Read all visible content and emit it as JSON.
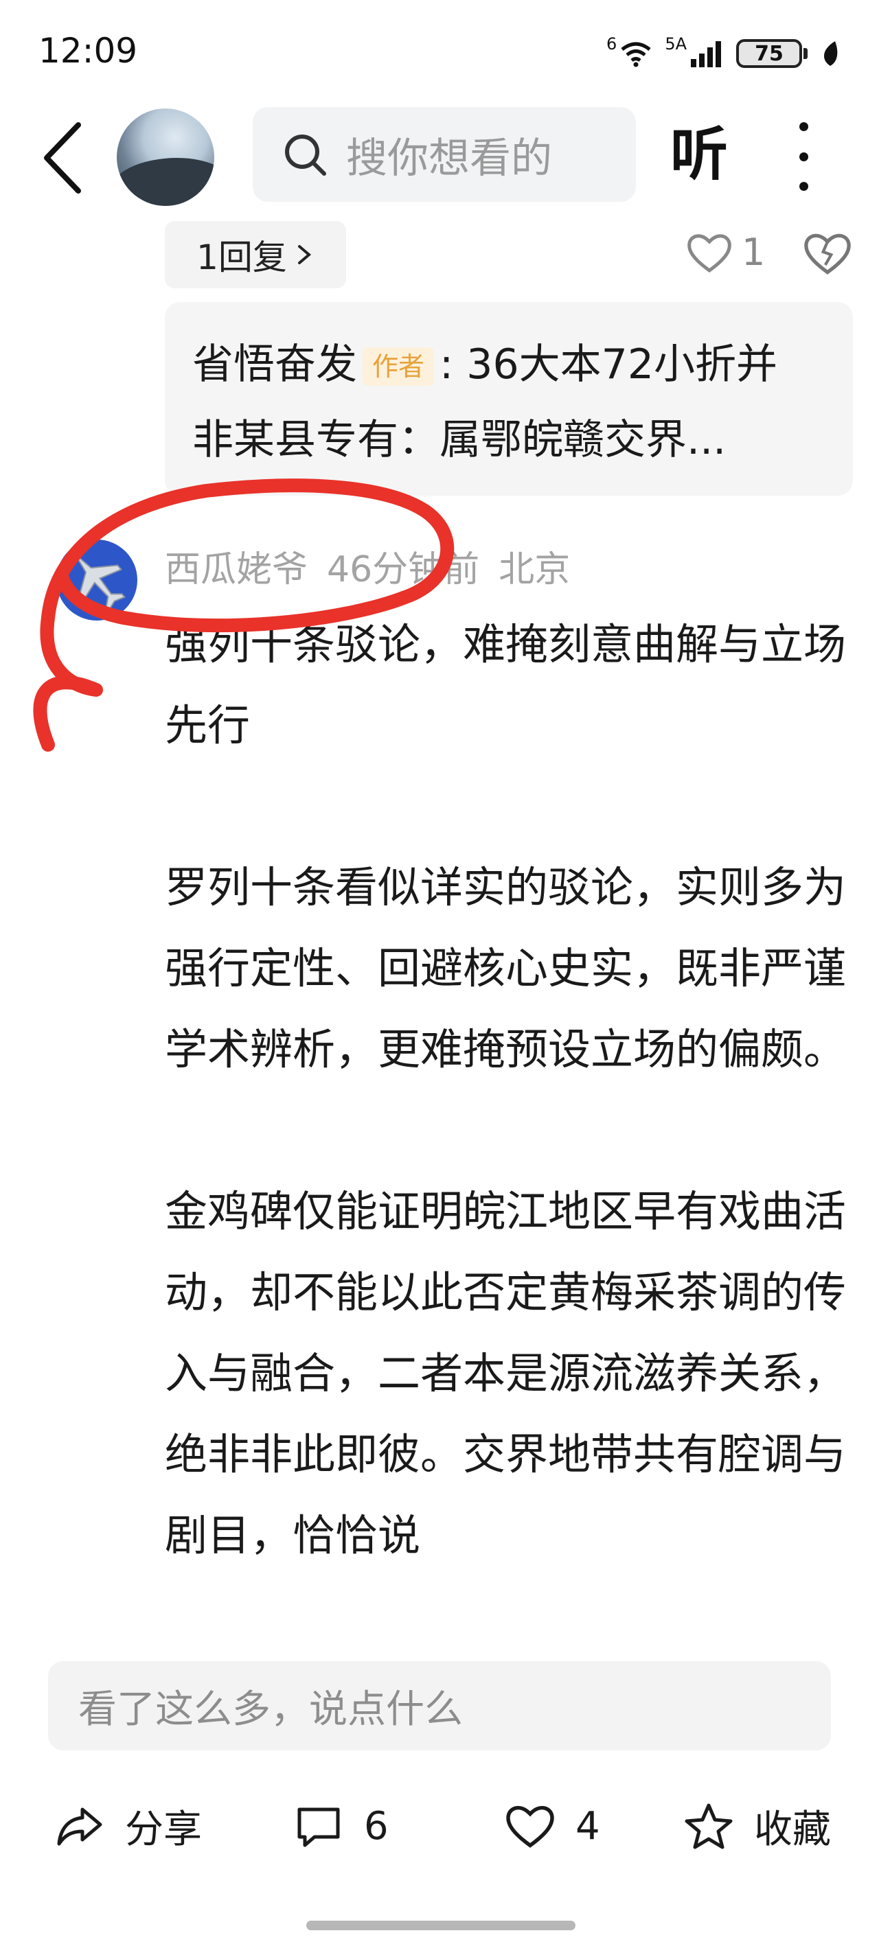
{
  "status_bar": {
    "time": "12:09",
    "network_1": "6",
    "network_2": "5A",
    "battery": "75",
    "icons": [
      "wifi-icon",
      "signal-icon",
      "battery-icon",
      "leaf-icon"
    ]
  },
  "top_bar": {
    "back_icon": "chevron-left-icon",
    "search_placeholder": "搜你想看的",
    "listen_label": "听",
    "more_icon": "more-vertical-icon"
  },
  "reply_row": {
    "reply_label": "1回复",
    "like_count": "1"
  },
  "quote": {
    "author": "省悟奋发",
    "author_tag": "作者",
    "line1_text": ": 36大本72小折并",
    "line2_text": "非某县专有：属鄂皖赣交界..."
  },
  "comment": {
    "username": "西瓜姥爷",
    "time_ago": "46分钟前",
    "location": "北京",
    "paragraphs": [
      "强列十条驳论，难掩刻意曲解与立场先行",
      "罗列十条看似详实的驳论，实则多为强行定性、回避核心史实，既非严谨学术辨析，更难掩预设立场的偏颇。",
      "金鸡碑仅能证明皖江地区早有戏曲活动，却不能以此否定黄梅采茶调的传入与融合，二者本是源流滋养关系，绝非非此即彼。交界地带共有腔调与剧目，恰恰说"
    ]
  },
  "bottom": {
    "input_placeholder": "看了这么多，说点什么",
    "share_label": "分享",
    "comment_count": "6",
    "like_count": "4",
    "favorite_label": "收藏"
  },
  "colors": {
    "accent_tag": "#e6a23c",
    "annotation_red": "#e8322a",
    "avatar_blue": "#2d57c9"
  }
}
